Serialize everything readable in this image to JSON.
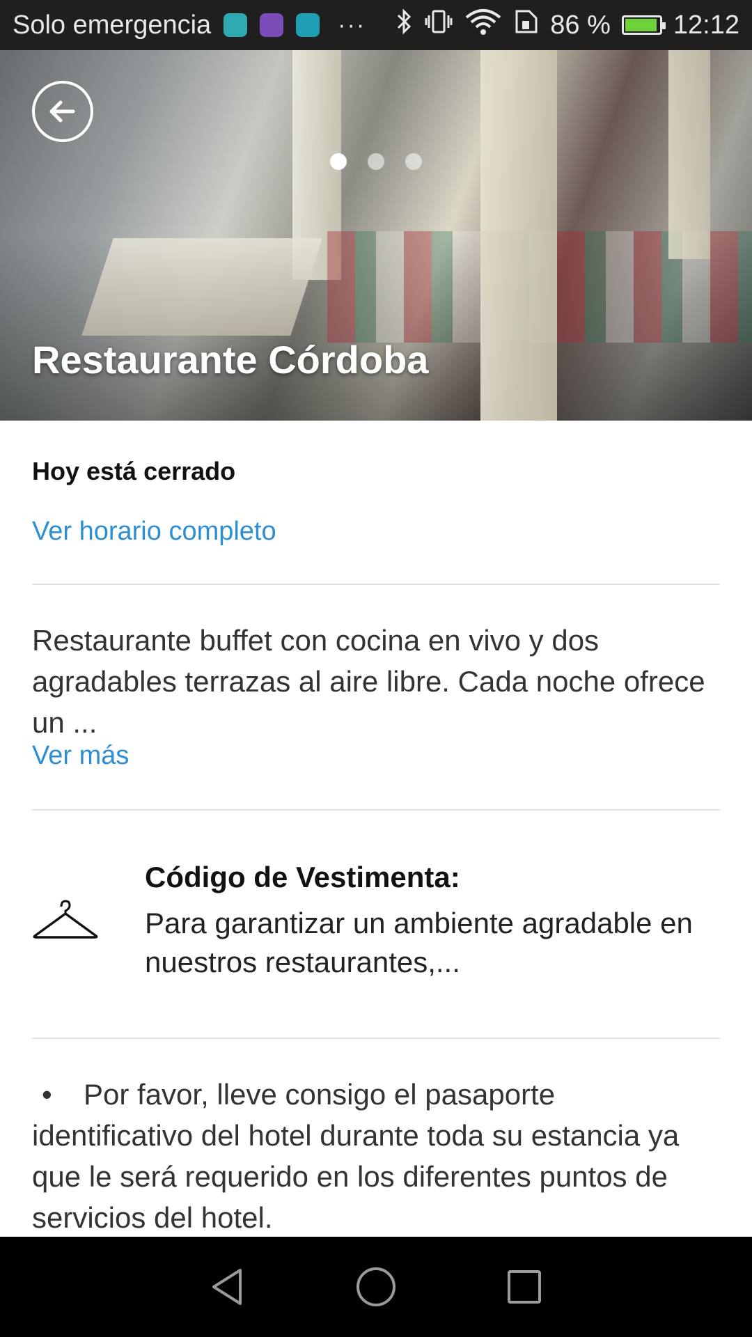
{
  "status_bar": {
    "carrier": "Solo emergencia",
    "battery_percent": "86 %",
    "battery_level": 0.86,
    "time": "12:12",
    "overflow": "···"
  },
  "hero": {
    "title": "Restaurante Córdoba",
    "slide_count": 3,
    "active_slide": 0
  },
  "schedule": {
    "status": "Hoy está cerrado",
    "link": "Ver horario completo"
  },
  "description": {
    "text": "Restaurante buffet con cocina en vivo y dos agradables terrazas al aire libre. Cada noche ofrece un ...",
    "more_link": "Ver más"
  },
  "dress_code": {
    "title": "Código de Vestimenta:",
    "text": "Para garantizar un ambiente agradable en nuestros restaurantes,...",
    "icon": "hanger-icon"
  },
  "notice": {
    "bullet": "•",
    "text": "Por favor, lleve consigo el pasaporte identificativo del hotel durante toda su estancia ya que le será requerido en los diferentes puntos de servicios del hotel."
  },
  "colors": {
    "link": "#2d8fd3",
    "status_bar": "#1f1f1f",
    "nav_bar": "#000000"
  }
}
